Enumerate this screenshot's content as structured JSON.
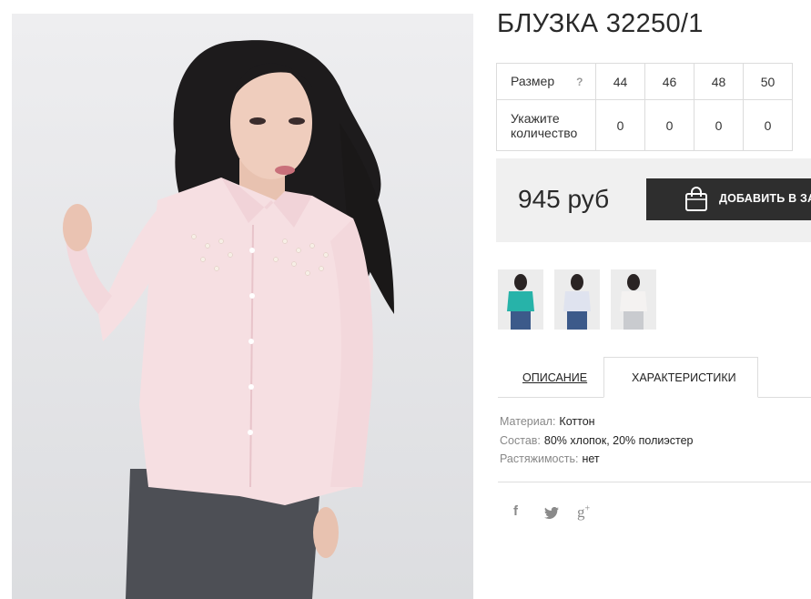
{
  "product": {
    "title": "БЛУЗКА 32250/1",
    "image_alt": "Model wearing pale pink blouse with pearl embellishment"
  },
  "sizes": {
    "row_label": "Размер",
    "help": "?",
    "qty_label": "Укажите количество",
    "values": [
      "44",
      "46",
      "48",
      "50"
    ],
    "quantities": [
      "0",
      "0",
      "0",
      "0"
    ]
  },
  "price": {
    "value": "945 руб",
    "add_to_cart": "ДОБАВИТЬ В ЗАКАЗ"
  },
  "thumbnails": [
    {
      "color": "#27b3a9"
    },
    {
      "color": "#dfe3ef"
    },
    {
      "color": "#f4f2f1"
    }
  ],
  "tabs": {
    "description": "ОПИСАНИЕ",
    "characteristics": "ХАРАКТЕРИСТИКИ"
  },
  "specs": [
    {
      "key": "Материал:",
      "value": "Коттон"
    },
    {
      "key": "Состав:",
      "value": "80% хлопок, 20% полиэстер"
    },
    {
      "key": "Растяжимость:",
      "value": "нет"
    }
  ],
  "social": [
    "facebook-icon",
    "twitter-icon",
    "google-plus-icon"
  ],
  "colors": {
    "button_bg": "#2e2e2e",
    "price_bg": "#f0f0f0",
    "photo_bg": "#e5e6e8",
    "blouse": "#f6dfe2"
  }
}
